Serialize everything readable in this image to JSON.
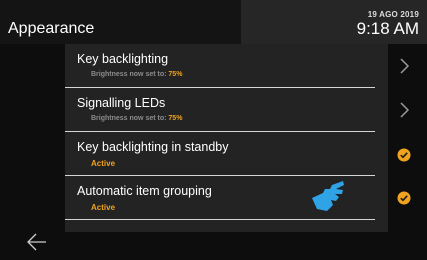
{
  "header": {
    "title": "Appearance",
    "date": "19 AGO 2019",
    "time": "9:18 AM"
  },
  "items": [
    {
      "label": "Key backlighting",
      "sub_prefix": "Brightness now set to: ",
      "sub_value": "75%",
      "control": "chevron-right-icon"
    },
    {
      "label": "Signalling LEDs",
      "sub_prefix": "Brightness now set to: ",
      "sub_value": "75%",
      "control": "chevron-right-icon"
    },
    {
      "label": "Key backlighting in standby",
      "status": "Active",
      "control": "check-circle-icon"
    },
    {
      "label": "Automatic item grouping",
      "status": "Active",
      "control": "check-circle-icon"
    }
  ],
  "footer": {
    "back_icon": "back-arrow-icon"
  },
  "colors": {
    "accent": "#f0a31f",
    "hand": "#2fa3e6",
    "background": "#000000",
    "panel": "#232323"
  }
}
